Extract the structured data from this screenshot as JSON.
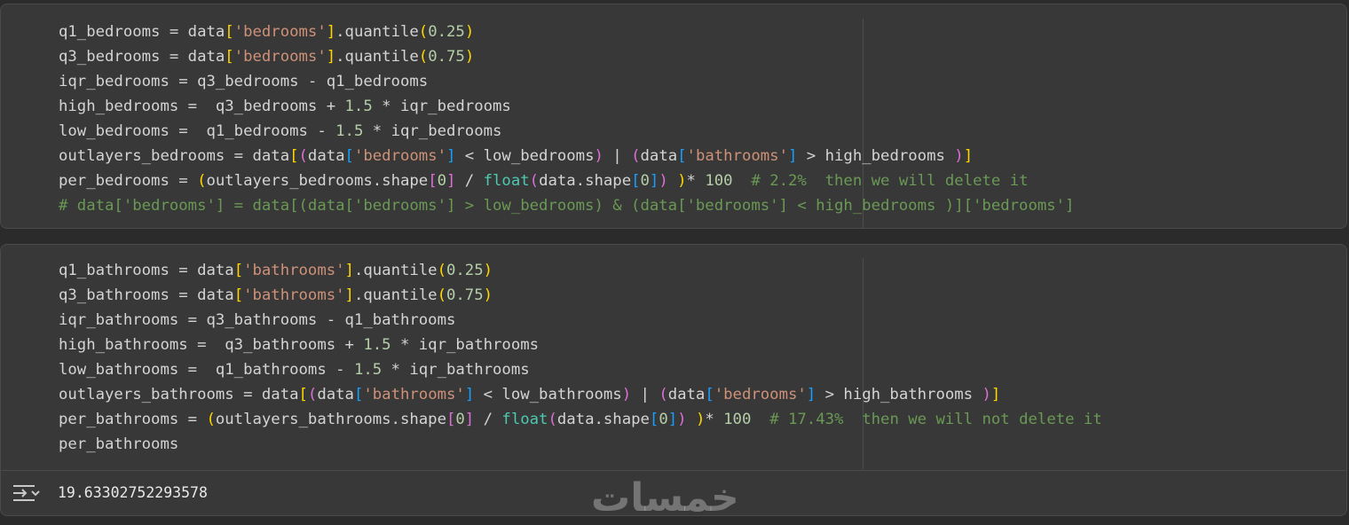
{
  "cells": [
    {
      "lines": [
        [
          [
            "q1_bedrooms = data",
            ""
          ],
          [
            "[",
            "b1"
          ],
          [
            "'bedrooms'",
            "str"
          ],
          [
            "]",
            "b1"
          ],
          [
            ".quantile",
            ""
          ],
          [
            "(",
            "b1"
          ],
          [
            "0.25",
            "num"
          ],
          [
            ")",
            "b1"
          ]
        ],
        [
          [
            "q3_bedrooms = data",
            ""
          ],
          [
            "[",
            "b1"
          ],
          [
            "'bedrooms'",
            "str"
          ],
          [
            "]",
            "b1"
          ],
          [
            ".quantile",
            ""
          ],
          [
            "(",
            "b1"
          ],
          [
            "0.75",
            "num"
          ],
          [
            ")",
            "b1"
          ]
        ],
        [
          [
            "iqr_bedrooms = q3_bedrooms - q1_bedrooms",
            ""
          ]
        ],
        [
          [
            "high_bedrooms =  q3_bedrooms + ",
            ""
          ],
          [
            "1.5",
            "num"
          ],
          [
            " * iqr_bedrooms",
            ""
          ]
        ],
        [
          [
            "low_bedrooms =  q1_bedrooms - ",
            ""
          ],
          [
            "1.5",
            "num"
          ],
          [
            " * iqr_bedrooms",
            ""
          ]
        ],
        [
          [
            "outlayers_bedrooms = data",
            ""
          ],
          [
            "[",
            "b1"
          ],
          [
            "(",
            "b2"
          ],
          [
            "data",
            ""
          ],
          [
            "[",
            "b3"
          ],
          [
            "'bedrooms'",
            "str"
          ],
          [
            "]",
            "b3"
          ],
          [
            " < low_bedrooms",
            ""
          ],
          [
            ")",
            "b2"
          ],
          [
            " | ",
            ""
          ],
          [
            "(",
            "b2"
          ],
          [
            "data",
            ""
          ],
          [
            "[",
            "b3"
          ],
          [
            "'bathrooms'",
            "str"
          ],
          [
            "]",
            "b3"
          ],
          [
            " > high_bedrooms ",
            ""
          ],
          [
            ")",
            "b2"
          ],
          [
            "]",
            "b1"
          ]
        ],
        [
          [
            "per_bedrooms = ",
            ""
          ],
          [
            "(",
            "b1"
          ],
          [
            "outlayers_bedrooms.shape",
            ""
          ],
          [
            "[",
            "b2"
          ],
          [
            "0",
            "num"
          ],
          [
            "]",
            "b2"
          ],
          [
            " / ",
            ""
          ],
          [
            "float",
            "fn"
          ],
          [
            "(",
            "b2"
          ],
          [
            "data.shape",
            ""
          ],
          [
            "[",
            "b3"
          ],
          [
            "0",
            "num"
          ],
          [
            "]",
            "b3"
          ],
          [
            ")",
            "b2"
          ],
          [
            " ",
            ""
          ],
          [
            ")",
            "b1"
          ],
          [
            "* ",
            ""
          ],
          [
            "100",
            "num"
          ],
          [
            "  ",
            ""
          ],
          [
            "# 2.2%  then we will delete it",
            "com"
          ]
        ],
        [
          [
            "# data['bedrooms'] = data[(data['bedrooms'] > low_bedrooms) & (data['bedrooms'] < high_bedrooms )]['bedrooms']",
            "com"
          ]
        ]
      ]
    },
    {
      "lines": [
        [
          [
            "q1_bathrooms = data",
            ""
          ],
          [
            "[",
            "b1"
          ],
          [
            "'bathrooms'",
            "str"
          ],
          [
            "]",
            "b1"
          ],
          [
            ".quantile",
            ""
          ],
          [
            "(",
            "b1"
          ],
          [
            "0.25",
            "num"
          ],
          [
            ")",
            "b1"
          ]
        ],
        [
          [
            "q3_bathrooms = data",
            ""
          ],
          [
            "[",
            "b1"
          ],
          [
            "'bathrooms'",
            "str"
          ],
          [
            "]",
            "b1"
          ],
          [
            ".quantile",
            ""
          ],
          [
            "(",
            "b1"
          ],
          [
            "0.75",
            "num"
          ],
          [
            ")",
            "b1"
          ]
        ],
        [
          [
            "iqr_bathrooms = q3_bathrooms - q1_bathrooms",
            ""
          ]
        ],
        [
          [
            "high_bathrooms =  q3_bathrooms + ",
            ""
          ],
          [
            "1.5",
            "num"
          ],
          [
            " * iqr_bathrooms",
            ""
          ]
        ],
        [
          [
            "low_bathrooms =  q1_bathrooms - ",
            ""
          ],
          [
            "1.5",
            "num"
          ],
          [
            " * iqr_bathrooms",
            ""
          ]
        ],
        [
          [
            "outlayers_bathrooms = data",
            ""
          ],
          [
            "[",
            "b1"
          ],
          [
            "(",
            "b2"
          ],
          [
            "data",
            ""
          ],
          [
            "[",
            "b3"
          ],
          [
            "'bathrooms'",
            "str"
          ],
          [
            "]",
            "b3"
          ],
          [
            " < low_bathrooms",
            ""
          ],
          [
            ")",
            "b2"
          ],
          [
            " | ",
            ""
          ],
          [
            "(",
            "b2"
          ],
          [
            "data",
            ""
          ],
          [
            "[",
            "b3"
          ],
          [
            "'bedrooms'",
            "str"
          ],
          [
            "]",
            "b3"
          ],
          [
            " > high_bathrooms ",
            ""
          ],
          [
            ")",
            "b2"
          ],
          [
            "]",
            "b1"
          ]
        ],
        [
          [
            "per_bathrooms = ",
            ""
          ],
          [
            "(",
            "b1"
          ],
          [
            "outlayers_bathrooms.shape",
            ""
          ],
          [
            "[",
            "b2"
          ],
          [
            "0",
            "num"
          ],
          [
            "]",
            "b2"
          ],
          [
            " / ",
            ""
          ],
          [
            "float",
            "fn"
          ],
          [
            "(",
            "b2"
          ],
          [
            "data.shape",
            ""
          ],
          [
            "[",
            "b3"
          ],
          [
            "0",
            "num"
          ],
          [
            "]",
            "b3"
          ],
          [
            ")",
            "b2"
          ],
          [
            " ",
            ""
          ],
          [
            ")",
            "b1"
          ],
          [
            "* ",
            ""
          ],
          [
            "100",
            "num"
          ],
          [
            "  ",
            ""
          ],
          [
            "# 17.43%  then we will not delete it",
            "com"
          ]
        ],
        [
          [
            "per_bathrooms",
            ""
          ]
        ]
      ],
      "output": {
        "icon": "output-toggle-icon",
        "text": "19.63302752293578"
      }
    }
  ],
  "watermark": {
    "text": "خمسات"
  },
  "colors": {
    "background": "#2b2b2b",
    "cell_background": "#383838",
    "default_text": "#d4d4d4",
    "string": "#ce9178",
    "number": "#b5cea8",
    "comment": "#6a9955",
    "builtin": "#4ec9b0",
    "bracket_level_1": "#ffd700",
    "bracket_level_2": "#da70d6",
    "bracket_level_3": "#179fff"
  }
}
